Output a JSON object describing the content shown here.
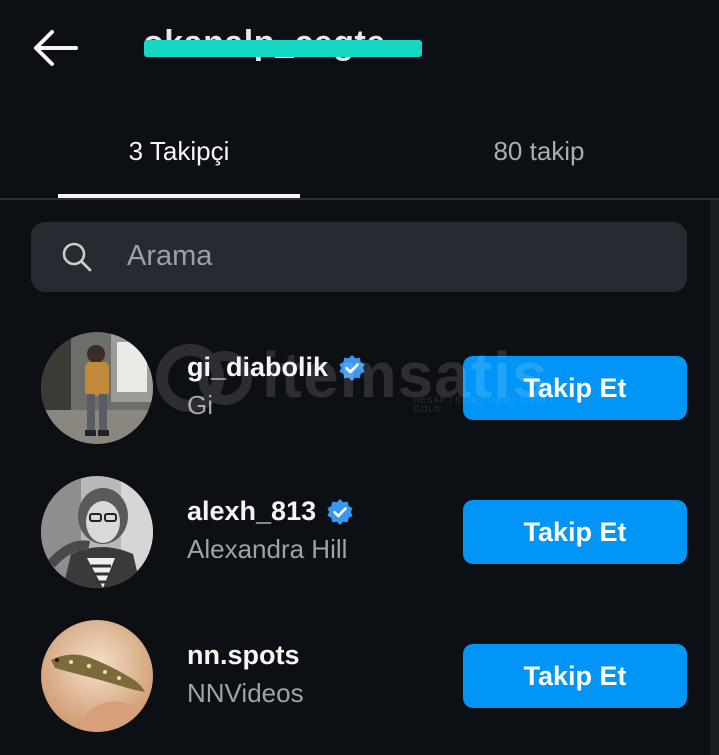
{
  "header": {
    "username": "okanalp_cegte",
    "back_icon": "arrow-left-icon"
  },
  "tabs": [
    {
      "label": "3 Takipçi",
      "active": true
    },
    {
      "label": "80 takip",
      "active": false
    }
  ],
  "search": {
    "placeholder": "Arama",
    "icon": "search-icon"
  },
  "watermark": {
    "text": "itemsatis",
    "subtext": "HESAP | SKIN | ITEM | E-PIN | GOLD"
  },
  "users": [
    {
      "username": "gi_diabolik",
      "full_name": "Gi",
      "verified": true,
      "button_label": "Takip Et"
    },
    {
      "username": "alexh_813",
      "full_name": "Alexandra Hill",
      "verified": true,
      "button_label": "Takip Et"
    },
    {
      "username": "nn.spots",
      "full_name": "NNVideos",
      "verified": false,
      "button_label": "Takip Et"
    }
  ],
  "colors": {
    "background": "#0c0f14",
    "button": "#0095f6",
    "verified_badge": "#3897f0",
    "redaction": "#17d8c4"
  }
}
